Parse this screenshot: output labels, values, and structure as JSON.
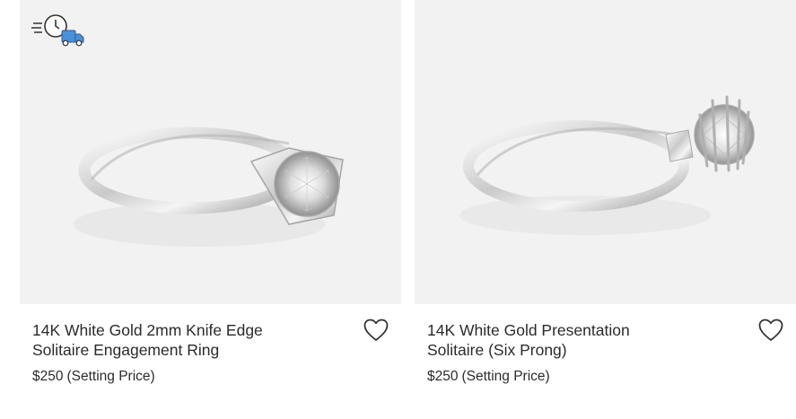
{
  "products": [
    {
      "title_line1": "14K White Gold 2mm Knife Edge",
      "title_line2": "Solitaire Engagement Ring",
      "price": "$250",
      "price_note": "(Setting Price)",
      "icons": [
        "fast-shipping-icon",
        "heart-icon"
      ]
    },
    {
      "title_line1": "14K White Gold Presentation",
      "title_line2": "Solitaire (Six Prong)",
      "price": "$250",
      "price_note": "(Setting Price)",
      "icons": [
        "heart-icon"
      ]
    }
  ],
  "colors": {
    "text": "#2b2b2b",
    "image_bg": "#f2f2f2",
    "shipping_truck": "#4a90d9",
    "icon_stroke": "#333333"
  }
}
